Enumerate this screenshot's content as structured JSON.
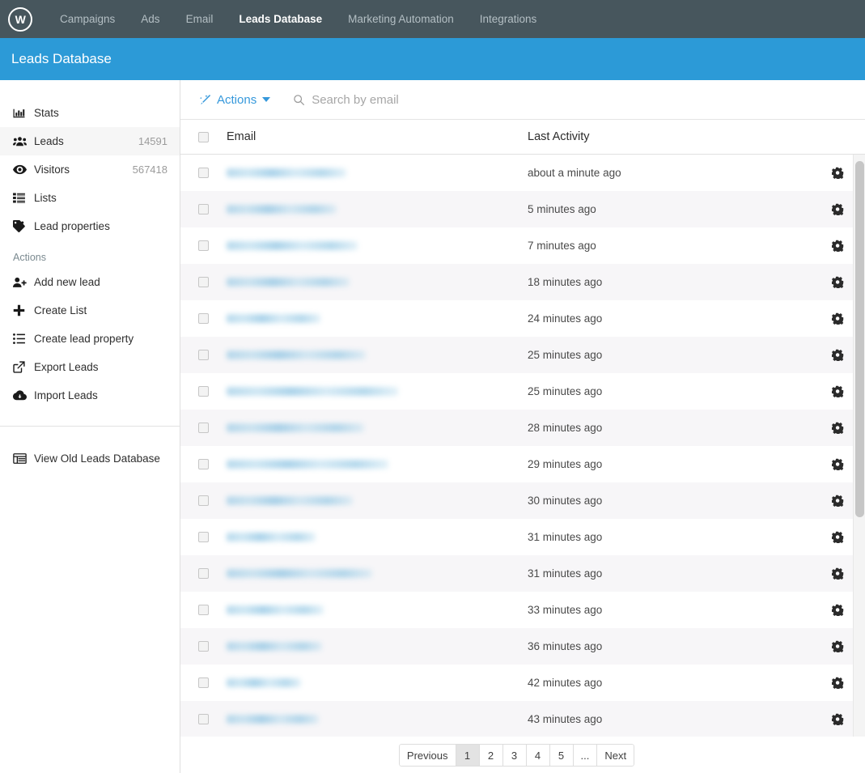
{
  "app": {
    "logo_letter": "W",
    "logo_icon": "circle-w-logo-icon"
  },
  "navbar": {
    "items": [
      {
        "label": "Campaigns",
        "active": false
      },
      {
        "label": "Ads",
        "active": false
      },
      {
        "label": "Email",
        "active": false
      },
      {
        "label": "Leads Database",
        "active": true
      },
      {
        "label": "Marketing Automation",
        "active": false
      },
      {
        "label": "Integrations",
        "active": false
      }
    ]
  },
  "header": {
    "title": "Leads Database",
    "background": "#2c9ad7"
  },
  "sidebar": {
    "nav": [
      {
        "label": "Stats",
        "count": "",
        "icon": "bar-chart-icon",
        "selected": false
      },
      {
        "label": "Leads",
        "count": "14591",
        "icon": "users-icon",
        "selected": true
      },
      {
        "label": "Visitors",
        "count": "567418",
        "icon": "eye-icon",
        "selected": false
      },
      {
        "label": "Lists",
        "count": "",
        "icon": "list-icon",
        "selected": false
      },
      {
        "label": "Lead properties",
        "count": "",
        "icon": "tag-icon",
        "selected": false
      }
    ],
    "actions_heading": "Actions",
    "actions": [
      {
        "label": "Add new lead",
        "icon": "user-plus-icon"
      },
      {
        "label": "Create List",
        "icon": "plus-icon"
      },
      {
        "label": "Create lead property",
        "icon": "list-ul-icon"
      },
      {
        "label": "Export Leads",
        "icon": "external-link-icon"
      },
      {
        "label": "Import Leads",
        "icon": "cloud-download-icon"
      }
    ],
    "footer": [
      {
        "label": "View Old Leads Database",
        "icon": "table-icon"
      }
    ]
  },
  "toolbar": {
    "actions_label": "Actions",
    "actions_icon": "magic-wand-icon",
    "caret_icon": "caret-down-icon",
    "search_icon": "search-icon",
    "search_placeholder": "Search by email",
    "search_value": ""
  },
  "table": {
    "columns": {
      "select_all": "select-all-checkbox",
      "email": "Email",
      "last_activity": "Last Activity",
      "settings": ""
    },
    "row_gear_icon": "gear-icon",
    "rows": [
      {
        "email": "",
        "email_redacted": true,
        "blur_width": 148,
        "last_activity": "about a minute ago"
      },
      {
        "email": "",
        "email_redacted": true,
        "blur_width": 136,
        "last_activity": "5 minutes ago"
      },
      {
        "email": "",
        "email_redacted": true,
        "blur_width": 162,
        "last_activity": "7 minutes ago"
      },
      {
        "email": "",
        "email_redacted": true,
        "blur_width": 152,
        "last_activity": "18 minutes ago"
      },
      {
        "email": "",
        "email_redacted": true,
        "blur_width": 116,
        "last_activity": "24 minutes ago"
      },
      {
        "email": "",
        "email_redacted": true,
        "blur_width": 172,
        "last_activity": "25 minutes ago"
      },
      {
        "email": "",
        "email_redacted": true,
        "blur_width": 212,
        "last_activity": "25 minutes ago"
      },
      {
        "email": "",
        "email_redacted": true,
        "blur_width": 170,
        "last_activity": "28 minutes ago"
      },
      {
        "email": "",
        "email_redacted": true,
        "blur_width": 200,
        "last_activity": "29 minutes ago"
      },
      {
        "email": "",
        "email_redacted": true,
        "blur_width": 156,
        "last_activity": "30 minutes ago"
      },
      {
        "email": "",
        "email_redacted": true,
        "blur_width": 110,
        "last_activity": "31 minutes ago"
      },
      {
        "email": "",
        "email_redacted": true,
        "blur_width": 180,
        "last_activity": "31 minutes ago"
      },
      {
        "email": "",
        "email_redacted": true,
        "blur_width": 120,
        "last_activity": "33 minutes ago"
      },
      {
        "email": "",
        "email_redacted": true,
        "blur_width": 118,
        "last_activity": "36 minutes ago"
      },
      {
        "email": "",
        "email_redacted": true,
        "blur_width": 92,
        "last_activity": "42 minutes ago"
      },
      {
        "email": "",
        "email_redacted": true,
        "blur_width": 114,
        "last_activity": "43 minutes ago"
      }
    ]
  },
  "pagination": {
    "previous": "Previous",
    "pages": [
      "1",
      "2",
      "3",
      "4",
      "5",
      "..."
    ],
    "active_page": "1",
    "next": "Next"
  }
}
